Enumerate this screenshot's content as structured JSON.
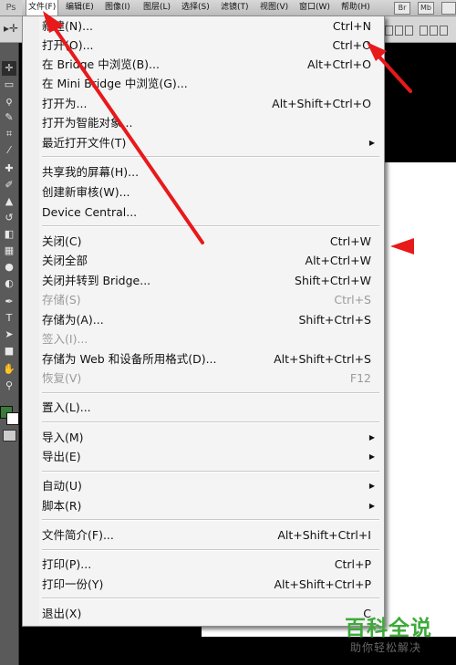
{
  "menubar": {
    "logo": "Ps",
    "items": [
      "文件(F)",
      "编辑(E)",
      "图像(I)",
      "图层(L)",
      "选择(S)",
      "滤镜(T)",
      "视图(V)",
      "窗口(W)",
      "帮助(H)"
    ],
    "buttons": [
      "Br",
      "Mb"
    ]
  },
  "optbar": {
    "tool_icon": "▸✛"
  },
  "file_menu": {
    "items": [
      {
        "label": "新建(N)...",
        "shortcut": "Ctrl+N"
      },
      {
        "label": "打开(O)...",
        "shortcut": "Ctrl+O"
      },
      {
        "label": "在 Bridge 中浏览(B)...",
        "shortcut": "Alt+Ctrl+O"
      },
      {
        "label": "在 Mini Bridge 中浏览(G)...",
        "shortcut": ""
      },
      {
        "label": "打开为...",
        "shortcut": "Alt+Shift+Ctrl+O"
      },
      {
        "label": "打开为智能对象...",
        "shortcut": ""
      },
      {
        "label": "最近打开文件(T)",
        "shortcut": ""
      },
      {
        "label": "共享我的屏幕(H)...",
        "shortcut": ""
      },
      {
        "label": "创建新审核(W)...",
        "shortcut": ""
      },
      {
        "label": "Device Central...",
        "shortcut": ""
      },
      {
        "label": "关闭(C)",
        "shortcut": "Ctrl+W"
      },
      {
        "label": "关闭全部",
        "shortcut": "Alt+Ctrl+W"
      },
      {
        "label": "关闭并转到 Bridge...",
        "shortcut": "Shift+Ctrl+W"
      },
      {
        "label": "存储(S)",
        "shortcut": "Ctrl+S"
      },
      {
        "label": "存储为(A)...",
        "shortcut": "Shift+Ctrl+S"
      },
      {
        "label": "签入(I)...",
        "shortcut": ""
      },
      {
        "label": "存储为 Web 和设备所用格式(D)...",
        "shortcut": "Alt+Shift+Ctrl+S"
      },
      {
        "label": "恢复(V)",
        "shortcut": "F12"
      },
      {
        "label": "置入(L)...",
        "shortcut": ""
      },
      {
        "label": "导入(M)",
        "shortcut": ""
      },
      {
        "label": "导出(E)",
        "shortcut": ""
      },
      {
        "label": "自动(U)",
        "shortcut": ""
      },
      {
        "label": "脚本(R)",
        "shortcut": ""
      },
      {
        "label": "文件简介(F)...",
        "shortcut": "Alt+Shift+Ctrl+I"
      },
      {
        "label": "打印(P)...",
        "shortcut": "Ctrl+P"
      },
      {
        "label": "打印一份(Y)",
        "shortcut": "Alt+Shift+Ctrl+P"
      },
      {
        "label": "退出(X)",
        "shortcut": "C"
      }
    ]
  },
  "submenu_arrow": "▶",
  "watermark": {
    "title": "百科全说",
    "subtitle": "助你轻松解决"
  },
  "colors": {
    "arrow": "#e8191b",
    "foreground": "#3a7a3a",
    "background": "#ffffff"
  }
}
